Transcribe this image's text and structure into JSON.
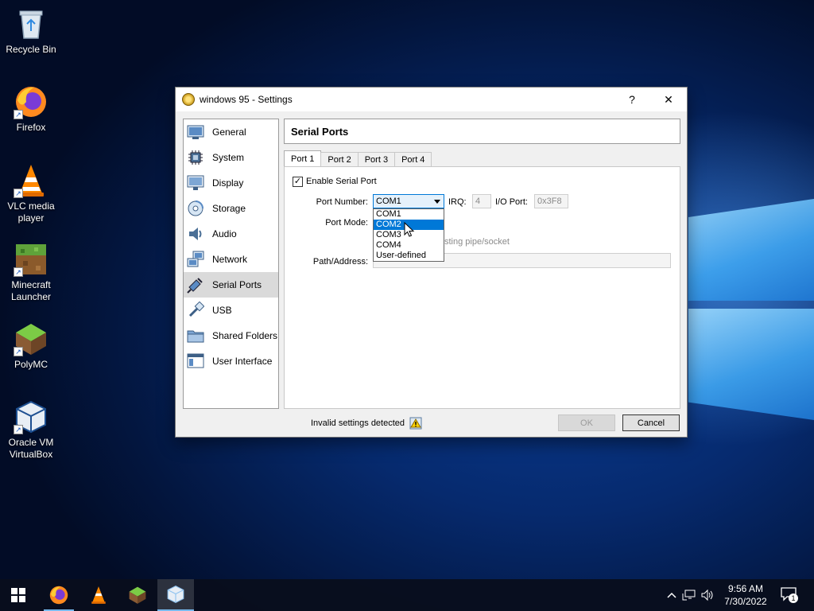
{
  "desktop": {
    "icons": [
      {
        "label": "Recycle Bin",
        "icon": "recycle-bin-icon"
      },
      {
        "label": "Firefox",
        "icon": "firefox-icon"
      },
      {
        "label": "VLC media player",
        "icon": "vlc-icon"
      },
      {
        "label": "Minecraft Launcher",
        "icon": "minecraft-icon"
      },
      {
        "label": "PolyMC",
        "icon": "polymc-icon"
      },
      {
        "label": "Oracle VM VirtualBox",
        "icon": "virtualbox-icon"
      }
    ]
  },
  "dialog": {
    "title": "windows 95 - Settings",
    "help_label": "?",
    "close_label": "✕",
    "nav": [
      {
        "label": "General",
        "icon": "general-icon"
      },
      {
        "label": "System",
        "icon": "system-icon"
      },
      {
        "label": "Display",
        "icon": "display-icon"
      },
      {
        "label": "Storage",
        "icon": "storage-icon"
      },
      {
        "label": "Audio",
        "icon": "audio-icon"
      },
      {
        "label": "Network",
        "icon": "network-icon"
      },
      {
        "label": "Serial Ports",
        "icon": "serial-ports-icon",
        "selected": true
      },
      {
        "label": "USB",
        "icon": "usb-icon"
      },
      {
        "label": "Shared Folders",
        "icon": "shared-folders-icon"
      },
      {
        "label": "User Interface",
        "icon": "user-interface-icon"
      }
    ],
    "section_title": "Serial Ports",
    "tabs": [
      {
        "label": "Port 1",
        "active": true
      },
      {
        "label": "Port 2"
      },
      {
        "label": "Port 3"
      },
      {
        "label": "Port 4"
      }
    ],
    "port": {
      "enable_label": "Enable Serial Port",
      "enabled": true,
      "check_mark": "✓",
      "port_number_label": "Port Number:",
      "port_number_value": "COM1",
      "port_number_options": [
        "COM1",
        "COM2",
        "COM3",
        "COM4",
        "User-defined"
      ],
      "highlighted_option": "COM2",
      "irq_label": "IRQ:",
      "irq_value": "4",
      "io_port_label": "I/O Port:",
      "io_port_value": "0x3F8",
      "port_mode_label": "Port Mode:",
      "existing_pipe_label_partial": "sting pipe/socket",
      "path_label": "Path/Address:",
      "path_value": ""
    },
    "footer": {
      "status": "Invalid settings detected",
      "ok_label": "OK",
      "cancel_label": "Cancel"
    }
  },
  "taskbar": {
    "apps": [
      "firefox-icon",
      "vlc-icon",
      "polymc-icon",
      "virtualbox-icon"
    ],
    "active_app": "virtualbox-icon",
    "time": "9:56 AM",
    "date": "7/30/2022",
    "notification_count": "1",
    "accent": "#76b9ed"
  }
}
